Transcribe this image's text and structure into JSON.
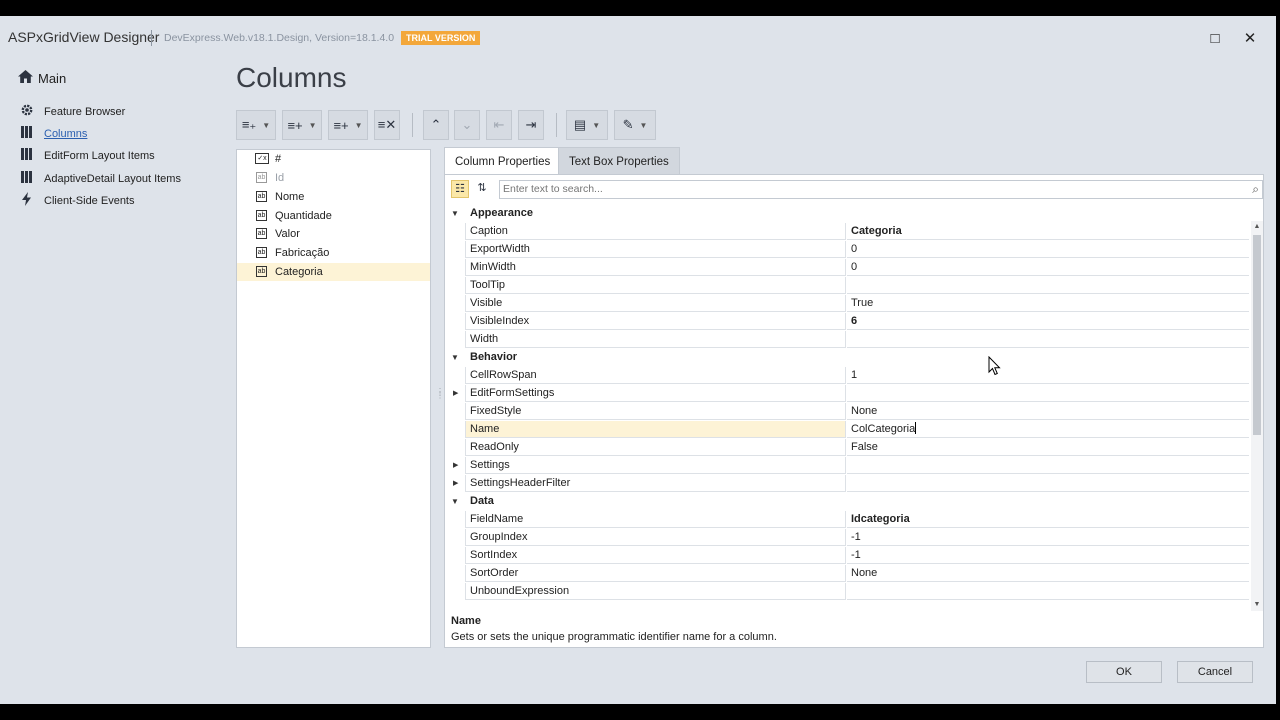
{
  "window": {
    "title": "ASPxGridView Designer",
    "version": "DevExpress.Web.v18.1.Design, Version=18.1.4.0",
    "trial_badge": "TRIAL VERSION",
    "maximize": "□",
    "close": "✕"
  },
  "nav": {
    "main": "Main",
    "items": [
      {
        "label": "Feature Browser",
        "icon": "gear-icon"
      },
      {
        "label": "Columns",
        "icon": "columns-icon",
        "active": true
      },
      {
        "label": "EditForm Layout Items",
        "icon": "columns-icon"
      },
      {
        "label": "AdaptiveDetail Layout Items",
        "icon": "columns-icon"
      },
      {
        "label": "Client-Side Events",
        "icon": "lightning-icon"
      }
    ]
  },
  "page": {
    "title": "Columns"
  },
  "columns": [
    {
      "label": "#",
      "icon": "command-column-icon"
    },
    {
      "label": "Id",
      "icon": "data-column-icon",
      "dim": true
    },
    {
      "label": "Nome",
      "icon": "data-column-icon"
    },
    {
      "label": "Quantidade",
      "icon": "data-column-icon"
    },
    {
      "label": "Valor",
      "icon": "data-column-icon"
    },
    {
      "label": "Fabricação",
      "icon": "data-column-icon"
    },
    {
      "label": "Categoria",
      "icon": "data-column-icon",
      "selected": true
    }
  ],
  "tabs": {
    "column_properties": "Column Properties",
    "textbox_properties": "Text Box Properties"
  },
  "search": {
    "placeholder": "Enter text to search..."
  },
  "properties": {
    "appearance": {
      "label": "Appearance",
      "rows": [
        {
          "name": "Caption",
          "value": "Categoria"
        },
        {
          "name": "ExportWidth",
          "value": "0"
        },
        {
          "name": "MinWidth",
          "value": "0"
        },
        {
          "name": "ToolTip",
          "value": ""
        },
        {
          "name": "Visible",
          "value": "True"
        },
        {
          "name": "VisibleIndex",
          "value": "6"
        },
        {
          "name": "Width",
          "value": ""
        }
      ]
    },
    "behavior": {
      "label": "Behavior",
      "rows": [
        {
          "name": "CellRowSpan",
          "value": "1"
        },
        {
          "name": "EditFormSettings",
          "value": ""
        },
        {
          "name": "FixedStyle",
          "value": "None"
        },
        {
          "name": "Name",
          "value": "ColCategoria"
        },
        {
          "name": "ReadOnly",
          "value": "False"
        },
        {
          "name": "Settings",
          "value": ""
        },
        {
          "name": "SettingsHeaderFilter",
          "value": ""
        }
      ]
    },
    "data": {
      "label": "Data",
      "rows": [
        {
          "name": "FieldName",
          "value": "Idcategoria"
        },
        {
          "name": "GroupIndex",
          "value": "-1"
        },
        {
          "name": "SortIndex",
          "value": "-1"
        },
        {
          "name": "SortOrder",
          "value": "None"
        },
        {
          "name": "UnboundExpression",
          "value": ""
        }
      ]
    }
  },
  "description": {
    "title": "Name",
    "text": "Gets or sets the unique programmatic identifier name for a column."
  },
  "buttons": {
    "ok": "OK",
    "cancel": "Cancel"
  },
  "colors": {
    "trial_badge": "#f3a73a",
    "selection": "#fdf3d6",
    "active_link": "#2b5fb0"
  }
}
